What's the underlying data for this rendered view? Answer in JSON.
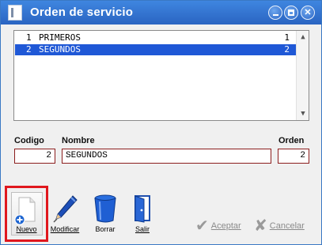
{
  "window": {
    "title": "Orden de servicio"
  },
  "list": {
    "rows": [
      {
        "num": "1",
        "name": "PRIMEROS",
        "order": "1",
        "selected": false
      },
      {
        "num": "2",
        "name": "SEGUNDOS",
        "order": "2",
        "selected": true
      }
    ]
  },
  "form": {
    "codigo_label": "Codigo",
    "codigo_value": "2",
    "nombre_label": "Nombre",
    "nombre_value": "SEGUNDOS",
    "orden_label": "Orden",
    "orden_value": "2"
  },
  "toolbar": {
    "nuevo_label": "Nuevo",
    "modificar_label": "Modificar",
    "borrar_label": "Borrar",
    "salir_label": "Salir",
    "aceptar_label": "Aceptar",
    "cancelar_label": "Cancelar"
  },
  "colors": {
    "titlebar": "#2a64c2",
    "selection": "#1f58d6",
    "field_border": "#8b1d1d",
    "highlight": "#e0171d"
  }
}
